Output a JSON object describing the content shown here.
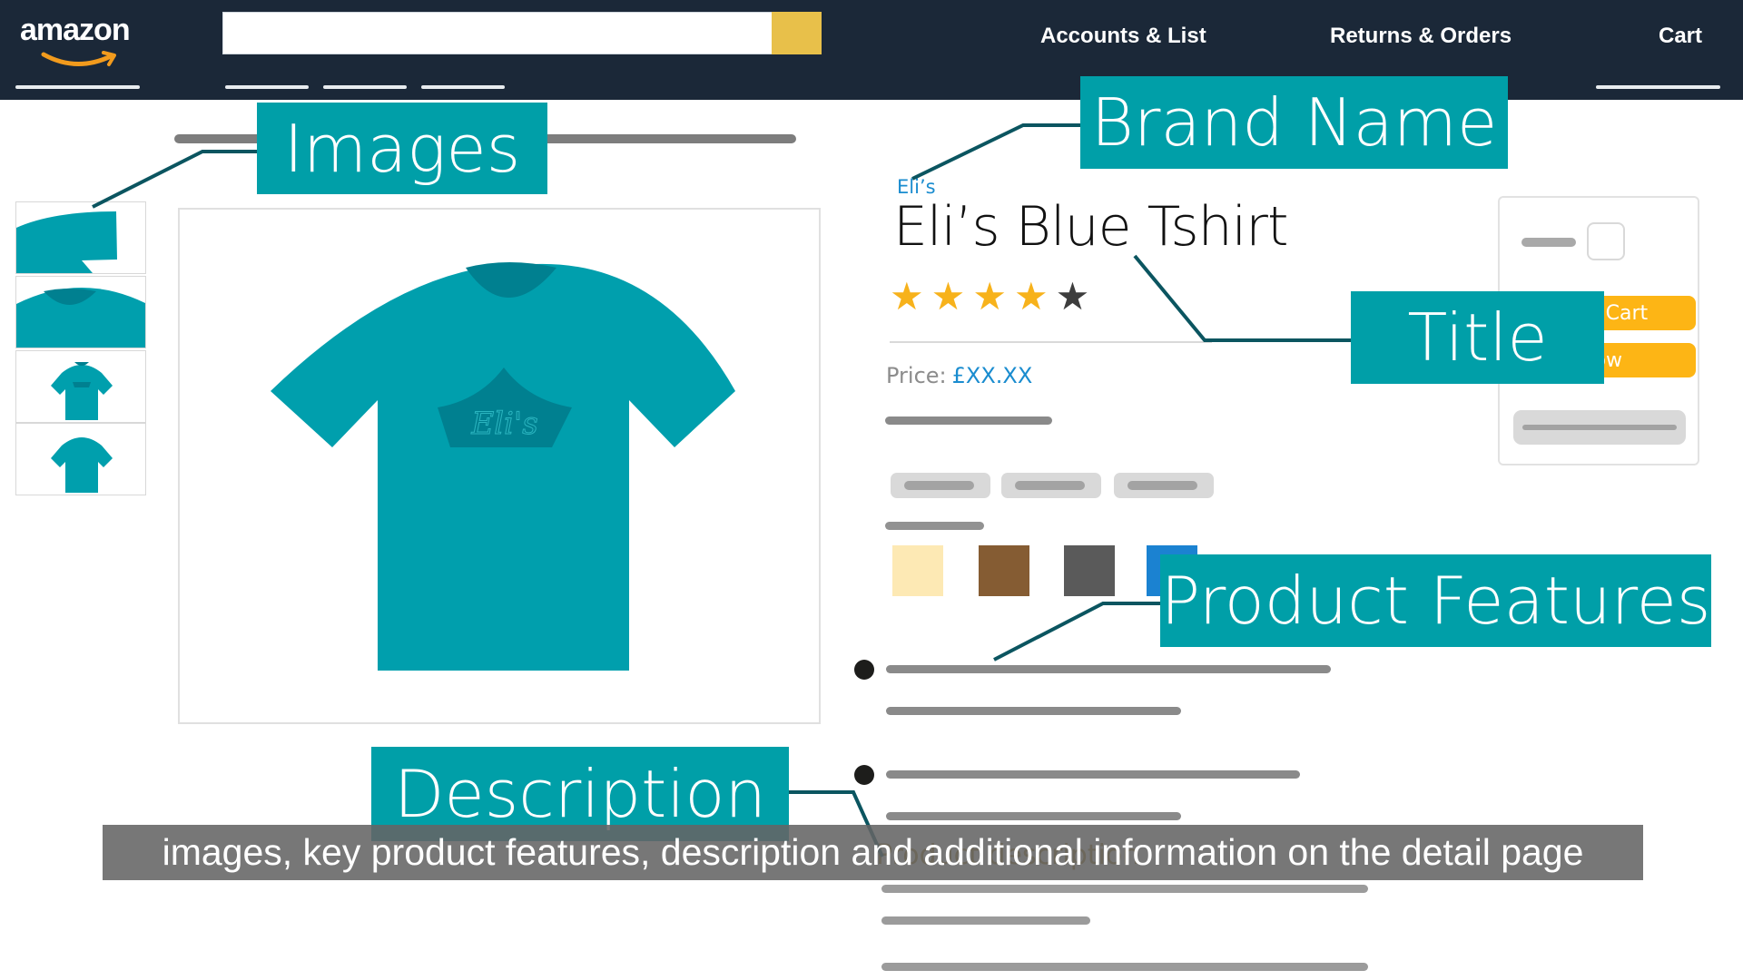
{
  "header": {
    "logo_text": "amazon",
    "search_placeholder": "",
    "nav": [
      "Accounts & List",
      "Returns & Orders",
      "Cart"
    ]
  },
  "callouts": {
    "images": "Images",
    "brand_name": "Brand Name",
    "title": "Title",
    "product_features": "Product Features",
    "description": "Description"
  },
  "product": {
    "brand": "Eli’s",
    "title": "Eli’s Blue Tshirt",
    "rating": {
      "value": 4,
      "max": 5
    },
    "price_label": "Price:",
    "price_value": "£XX.XX",
    "shirt_print": "Eli's",
    "swatches": [
      "#fde9b4",
      "#855c33",
      "#5a5a5a",
      "#1b82d1"
    ],
    "description_heading": "Product description"
  },
  "buybox": {
    "add_to_cart": "Add to Cart",
    "buy_now": "Buy Now"
  },
  "subtitle": "images, key product features, description and additional information on the detail page",
  "colors": {
    "header_bg": "#1b2838",
    "callout_teal": "#009fa8",
    "shirt_teal": "#009fad",
    "shirt_dark": "#008090",
    "search_button": "#e8c04a",
    "buy_button": "#fdb515",
    "link_blue": "#1a8ccf",
    "connector": "#0b5560"
  }
}
